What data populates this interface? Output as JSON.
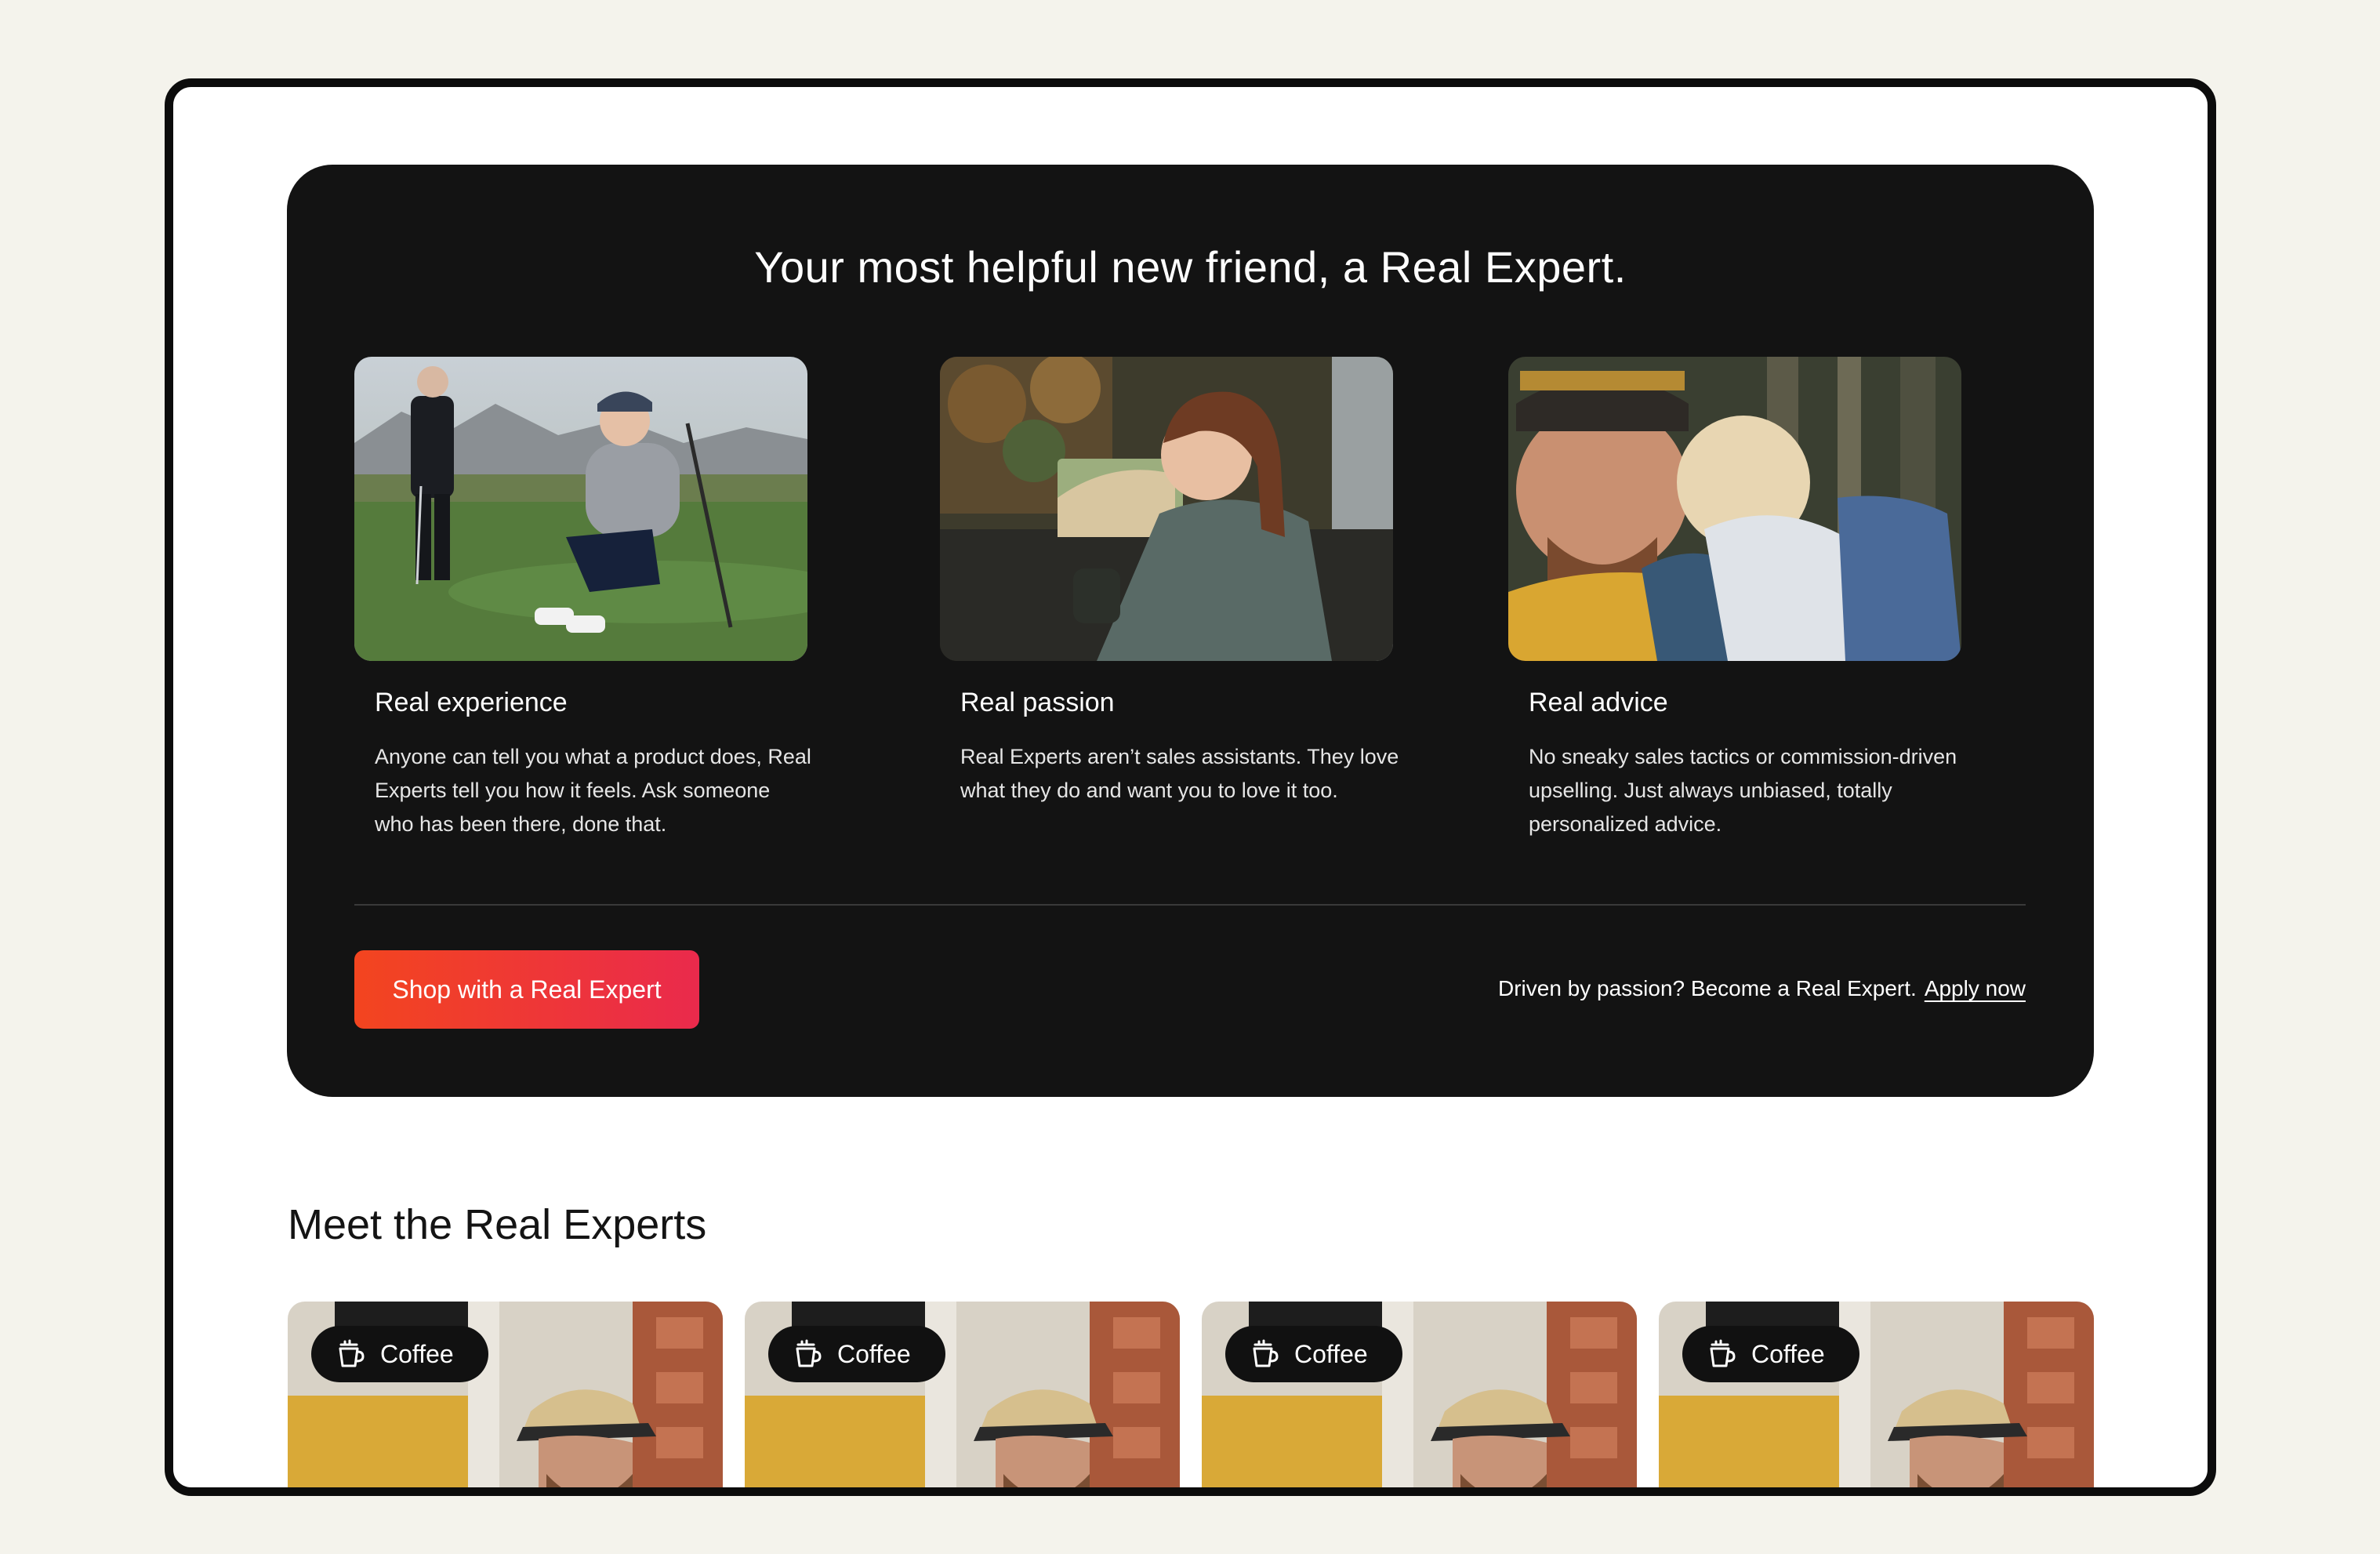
{
  "hero": {
    "title": "Your most helpful new friend, a Real Expert.",
    "cards": [
      {
        "title": "Real experience",
        "description": "Anyone can tell you what a product does, Real Experts tell you how it feels. Ask someone who has been there, done that.",
        "image_icon": "golf-photo"
      },
      {
        "title": "Real passion",
        "description": "Real Experts aren’t sales assistants. They love what they do and want you to love it too.",
        "image_icon": "coffee-mug-photo"
      },
      {
        "title": "Real advice",
        "description": "No sneaky sales tactics or commission-driven upselling. Just always unbiased, totally personalized advice.",
        "image_icon": "hiking-family-photo"
      }
    ],
    "cta_label": "Shop with a Real Expert",
    "apply_text": "Driven by passion? Become a Real Expert.",
    "apply_link": "Apply now"
  },
  "experts": {
    "title": "Meet the Real Experts",
    "cards": [
      {
        "category": "Coffee",
        "icon": "coffee-cup-icon"
      },
      {
        "category": "Coffee",
        "icon": "coffee-cup-icon"
      },
      {
        "category": "Coffee",
        "icon": "coffee-cup-icon"
      },
      {
        "category": "Coffee",
        "icon": "coffee-cup-icon"
      }
    ]
  },
  "colors": {
    "page_bg": "#f4f3ec",
    "hero_bg": "#131313",
    "cta_start": "#f3451f",
    "cta_end": "#ea2a4c"
  }
}
